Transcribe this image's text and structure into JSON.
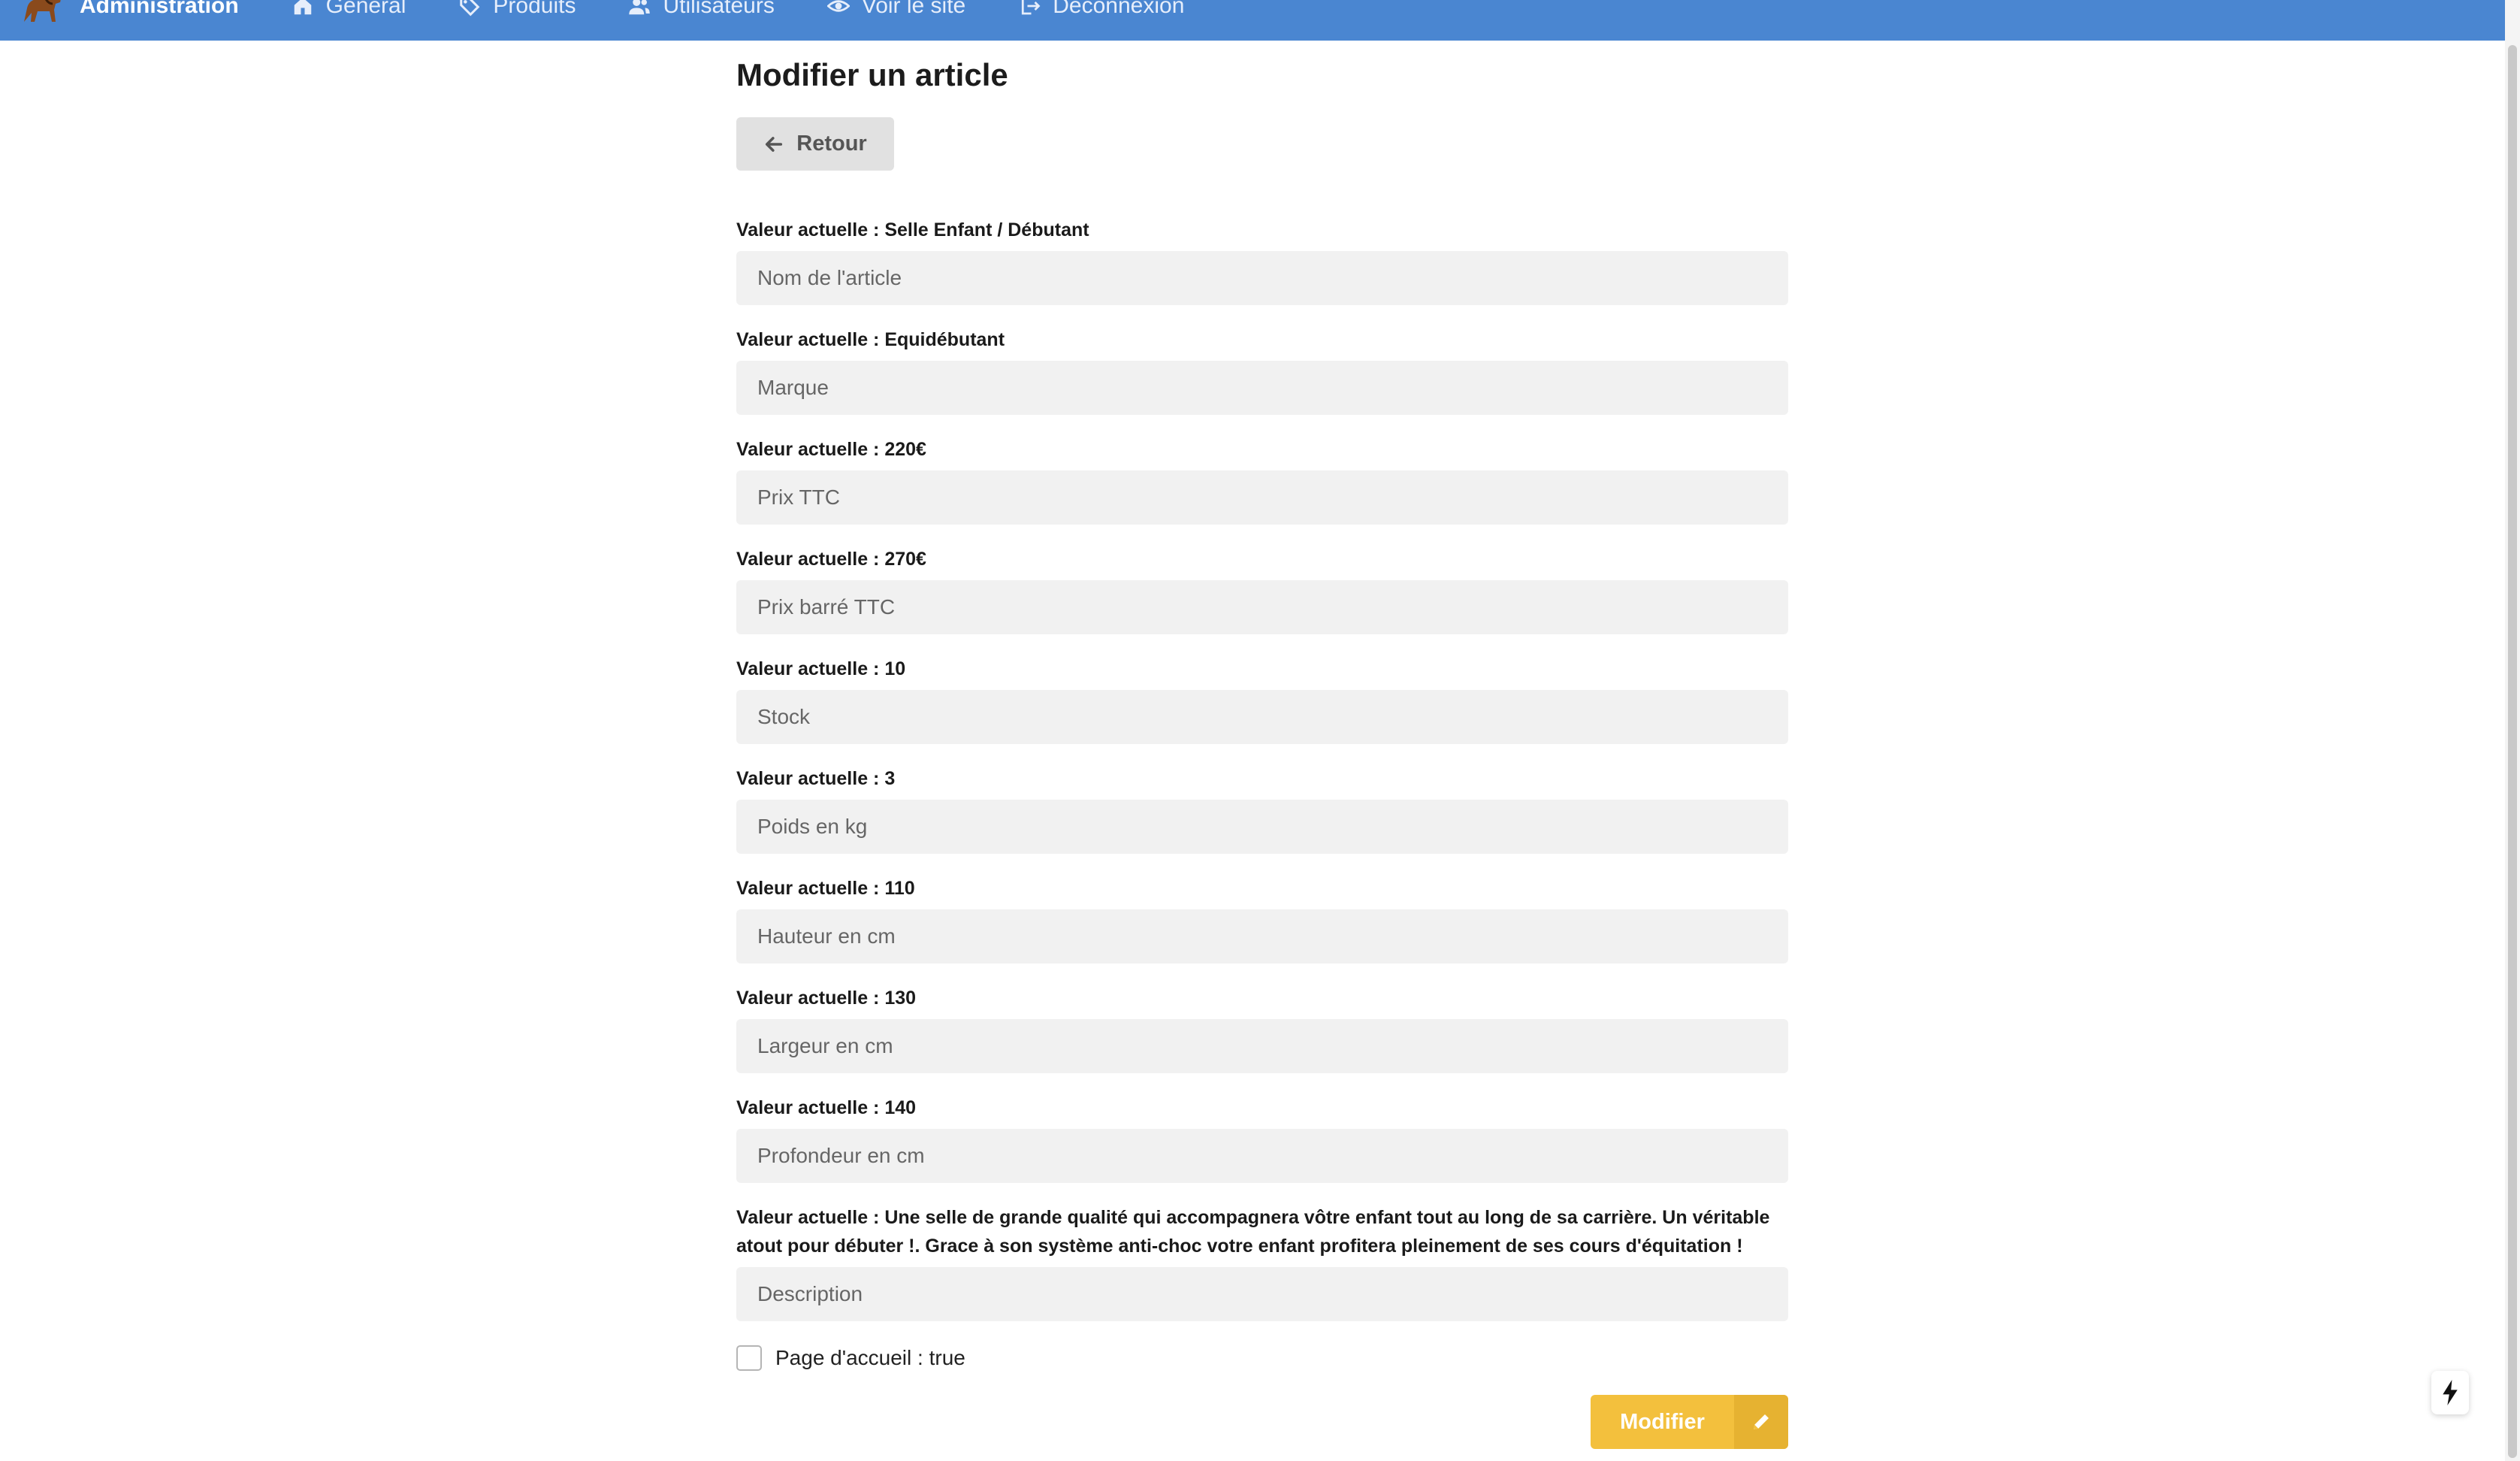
{
  "navbar": {
    "brand": "Administration",
    "items": [
      {
        "label": "Général",
        "icon": "home-icon"
      },
      {
        "label": "Produits",
        "icon": "tag-icon"
      },
      {
        "label": "Utilisateurs",
        "icon": "users-icon"
      },
      {
        "label": "Voir le site",
        "icon": "eye-icon"
      },
      {
        "label": "Déconnexion",
        "icon": "logout-icon"
      }
    ]
  },
  "page": {
    "title": "Modifier un article",
    "back_label": "Retour"
  },
  "fields": [
    {
      "label": "Valeur actuelle : Selle Enfant / Débutant",
      "placeholder": "Nom de l'article"
    },
    {
      "label": "Valeur actuelle : Equidébutant",
      "placeholder": "Marque"
    },
    {
      "label": "Valeur actuelle : 220€",
      "placeholder": "Prix TTC"
    },
    {
      "label": "Valeur actuelle : 270€",
      "placeholder": "Prix barré TTC"
    },
    {
      "label": "Valeur actuelle : 10",
      "placeholder": "Stock"
    },
    {
      "label": "Valeur actuelle : 3",
      "placeholder": "Poids en kg"
    },
    {
      "label": "Valeur actuelle : 110",
      "placeholder": "Hauteur en cm"
    },
    {
      "label": "Valeur actuelle : 130",
      "placeholder": "Largeur en cm"
    },
    {
      "label": "Valeur actuelle : 140",
      "placeholder": "Profondeur en cm"
    },
    {
      "label": "Valeur actuelle : Une selle de grande qualité qui accompagnera vôtre enfant tout au long de sa carrière. Un véritable atout pour débuter !. Grace à son système anti-choc votre enfant profitera pleinement de ses cours d'équitation !",
      "placeholder": "Description"
    }
  ],
  "homepage_checkbox": {
    "label": "Page d'accueil : true",
    "checked": false
  },
  "submit": {
    "label": "Modifier",
    "icon": "pencil-icon"
  },
  "colors": {
    "navbar": "#4a86d1",
    "submit": "#f3c03d",
    "input_bg": "#f1f1f1",
    "back_button": "#e1e1e1"
  }
}
